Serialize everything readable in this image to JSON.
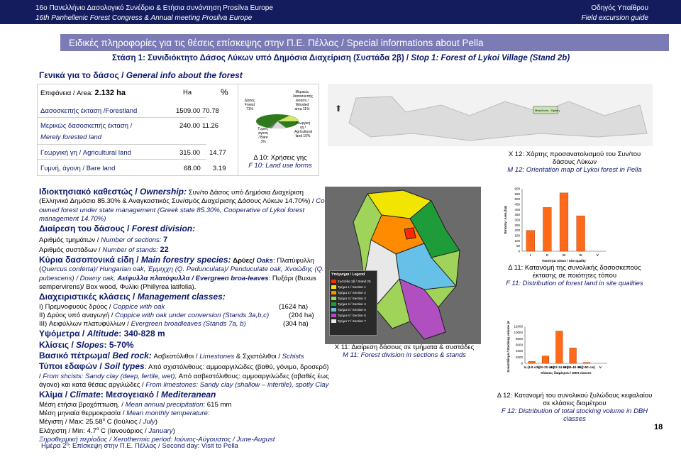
{
  "header": {
    "line1": "16ο Πανελλήνιο Δασολογικό Συνέδριο & Ετήσια συνάντηση Prosilva Europe",
    "line2": "16th Panhellenic Forest Congress & Annual meeting Prosilva Europe",
    "right1": "Οδηγός Υπαίθρου",
    "right2": "Field excursion guide",
    "bg_color": "#141c5e"
  },
  "banner": {
    "text": "Ειδικές πληροφορίες για τις θέσεις επίσκεψης στην Π.Ε. Πέλλας / Special informations about Pella",
    "color": "#7b7bb5"
  },
  "stop": {
    "gr": "Στάση 1: Συνιδιόκτητο Δάσος Λύκων υπό Δημόσια Διαχείριση (Συστάδα 2β) / ",
    "en": "Stop 1: Forest of Lykoi Village (Stand 2b)"
  },
  "general": {
    "gr": "Γενικά για το δάσος / ",
    "en": "General info about the forest"
  },
  "table": {
    "col_ha": "Ha",
    "col_pct": "%",
    "area_label": "Επιφάνεια / Area: ",
    "area_value": "2.132 ha",
    "rows": [
      {
        "label": "Δασοσκεπής έκταση /Forestland",
        "ha": "1509.00",
        "pct": "70.78"
      },
      {
        "label": "Μερικώς δασοσκεπής έκταση /",
        "label2": "Merely forested land",
        "ha": "240.00",
        "pct": "11.26"
      },
      {
        "label": "Γεωργική γη / Agricultural land",
        "ha": "315.00",
        "pct": "14.77"
      },
      {
        "label": "Γυμνή, άγονη  / Bare land",
        "ha": "68.00",
        "pct": "3.19"
      }
    ]
  },
  "pie": {
    "labels": [
      {
        "text": "Δάσος Forest 71%"
      },
      {
        "text": "Μερικώς δασοσκεπής έκταση / Wooded area 11%"
      },
      {
        "text": "Γεωργική γη / Agricultural land 15%"
      },
      {
        "text": "Γυμνή, άγονη / Bare 3%"
      }
    ],
    "caption_gr": "Δ 10: Χρήσεις γης",
    "caption_en": "F 10: Land use forms"
  },
  "orient_map": {
    "caption_gr": "Χ 12: Χάρτης προσανατολισμού του  Συν/του δάσους Λύκων",
    "caption_en": "M 12: Orientation map of Lykoi forest in Pella",
    "place_label": "Μακεδονία - Θράκη"
  },
  "body": {
    "ownership_h_gr": "Ιδιοκτησιακό καθεστώς / ",
    "ownership_h_en": "Ownership:",
    "ownership_t1": " Συν/το Δάσος υπό Δημόσια Διαχείριση (Ελληνικό Δημόσιο 85.30% & Αναγκαστικός Συν/σμός Διαχείρισης Δάσους Λύκων 14.70%) / ",
    "ownership_t2": "Co-owned forest under state management (Greek state 85.30%, Cooperative of Lykoi forest management 14.70%)",
    "division_h": "Διαίρεση του δάσους / ",
    "division_h_en": "Forest division:",
    "sections_l": "Αριθμός τμημάτων / ",
    "sections_l_en": "Number of sections: ",
    "sections_v": "7",
    "stands_l": "Αριθμός συστάδων / ",
    "stands_l_en": "Number of stands: ",
    "stands_v": "22",
    "species_h": "Κύρια δασοπονικά είδη / ",
    "species_h_en": "Main forestry species:",
    "species_t1": " Δρύες/ ",
    "species_t1_en": "Oaks",
    "species_t2": ": Πλατύφυλλη (",
    "species_t3": "Quercus conferta",
    "species_t4": ")/ Hungarian oak, Έμμιχχη (Q. Pedunculata)/ Penduculate oak, Χνοώδης (Q. pubescens) / Downy oak,",
    "species_t5": " Αείφυλλα πλατύφυλλα / Evergreen broa-leaves",
    "species_t6": ": Πυξάρι (Buxus sempervirens)/ Box wood, Φυλίκι (Phillyrea latifolia).",
    "mgmt_h": "Διαχειριστικές κλάσεις / ",
    "mgmt_h_en": "Management classes:",
    "mgmt": [
      {
        "gr": "I) Πρεμνοφυούς δρύος / ",
        "en": "Coppice with oak",
        "v": "(1624 ha)"
      },
      {
        "gr": "II) Δρύος υπό αναγωγή / ",
        "en": "Coppice with oak under conversion  (Stands 3a,b,c)",
        "v": "(204 ha)"
      },
      {
        "gr": "III) Αειφύλλων πλατυφύλλων / ",
        "en": "Evergreen broadleaves (Stands 7a, b)",
        "v": "(304 ha)"
      }
    ],
    "alt_l": "Υψόμετρα / ",
    "alt_l_en": "Altitude",
    "alt_v": ": 340-828 m",
    "slope_l": "Κλίσεις / ",
    "slope_l_en": "Slopes",
    "slope_v": ": 5-70%",
    "rock_l": "Βασικό πέτρωμα/ ",
    "rock_l_en": "Bed rock:",
    "rock_t": " Ασβεστόλιθοι / ",
    "rock_t_en": "Limestones",
    "rock_t2": " & Σχιστόλιθοι / ",
    "rock_t2_en": "Schists",
    "soil_l": "Τύποι εδαφών / ",
    "soil_l_en": "Soil types",
    "soil_t1": ": Από σχιστόλιθους: αμμοαργιλώδες (βαθύ, γόνιμο, δροσερό) / ",
    "soil_t1_en": "From shcists: Sandy clay (deep, fertile, wet),",
    "soil_t2": " Από ασβεστόλιθους: αμμοαργιλώδες (αβαθές έως άγονο) και κατά θέσεις αργιλώδες  / ",
    "soil_t2_en": "From limestones: Sandy clay (shallow – infertile), spotly Clay",
    "climate_l": "Κλίμα / ",
    "climate_l_en": "Climate",
    "climate_v": ": Μεσογειακό / ",
    "climate_v_en": "Mediteranean",
    "precip_gr": "Μέση ετήσια βροχόπτωση. / ",
    "precip_en": "Mean annual precipitation",
    "precip_v": ": 615 mm",
    "temp_gr": "Μέση μηνιαία θερμοκρασία / ",
    "temp_en": "Mean monthly  temperature:",
    "max_v": "Μέγιστη / Max: 25.58",
    "max_sup": "o",
    "max_unit": " C (Ιούλιος / ",
    "max_en": "July",
    "max_end": ")",
    "min_v": "Ελάχιστη / Min: 4.7",
    "min_sup": "o",
    "min_unit": " C (Ιανουάριος / ",
    "min_en": "January",
    "min_end": ")",
    "xero_gr": "Ξηροθερμική περίοδος / ",
    "xero_en": "Xerothermic period",
    "xero_v": ": Ιούνιος-Αύγουστος / ",
    "xero_v_en": "June-August"
  },
  "forest_map": {
    "caption_gr": "Χ 11: Διαίρεση δάσους σε τμήματα & συστάδες",
    "caption_en": "M 11: Forest division in sections & stands",
    "legend_title": "Υπόμνημα / Legend",
    "legend": [
      {
        "label": "Συστάδα 2β / Stand 2b",
        "color": "#ff2a00"
      },
      {
        "label": "Τμήμα 1 / Section 1",
        "color": "#f2e600"
      },
      {
        "label": "Τμήμα 2 / Section 2",
        "color": "#ff8c00"
      },
      {
        "label": "Τμήμα 3 / Section 3",
        "color": "#9fd35a"
      },
      {
        "label": "Τμήμα 4 / Section 4",
        "color": "#1f9c3a"
      },
      {
        "label": "Τμήμα 5 / Section 5",
        "color": "#67c0e8"
      },
      {
        "label": "Τμήμα 6 / Section 6",
        "color": "#b04fbf"
      },
      {
        "label": "Τμήμα 7 / Section 7",
        "color": "#e8e8e8"
      }
    ]
  },
  "chart11_caption": {
    "gr": "Δ 11: Κατανομή της συνολικής δασοσκεπούς έκτασης σε ποιότητες τόπου",
    "en": "F 11: Distribution of forest land in site qualities"
  },
  "chart12_caption": {
    "gr": "Δ 12: Κατανομή του συνολικού ξυλώδους κεφαλαίου σε κλάσεις διαμέτρου",
    "en": "F 12: Distribution of total stocking volume in DBH classes"
  },
  "chart_data": [
    {
      "type": "bar",
      "title": "",
      "xlabel": "Ποιότητα τόπου / Site quality",
      "ylabel": "Έκταση / Area (ha)",
      "categories": [
        "I",
        "II",
        "III",
        "IV",
        "V"
      ],
      "values": [
        200,
        420,
        560,
        340,
        0
      ],
      "ylim": [
        0,
        600
      ],
      "yticks": [
        "0",
        "50",
        "100",
        "150",
        "200",
        "250",
        "300",
        "350",
        "400",
        "450",
        "500",
        "550",
        "600"
      ],
      "color": "#ff6a1a",
      "grid": false
    },
    {
      "type": "bar",
      "title": "",
      "xlabel": "Κλάσεις διαμέτρου / DBH classes",
      "ylabel": "Ξυλαπόθεμα / Stocking volume (m3)",
      "categories": [
        "Ia (4-8 cm)",
        "I (10-20 cm)",
        "II (22-34 cm)",
        "III (36-48 cm)",
        "IV (>50 cm)",
        "V"
      ],
      "values": [
        600,
        2400,
        10500,
        5000,
        300,
        0
      ],
      "ylim": [
        0,
        12000
      ],
      "yticks": [
        "0",
        "2000",
        "4000",
        "6000",
        "8000",
        "10000",
        "12000"
      ],
      "color": "#ff6a1a",
      "grid": false
    }
  ],
  "footer": {
    "gr": "Ημέρα 2",
    "sup": "η",
    "rest": ": Επίσκεψη στην Π.Ε. Πέλλας / Second day: Visit to Pella"
  },
  "page_number": "18"
}
